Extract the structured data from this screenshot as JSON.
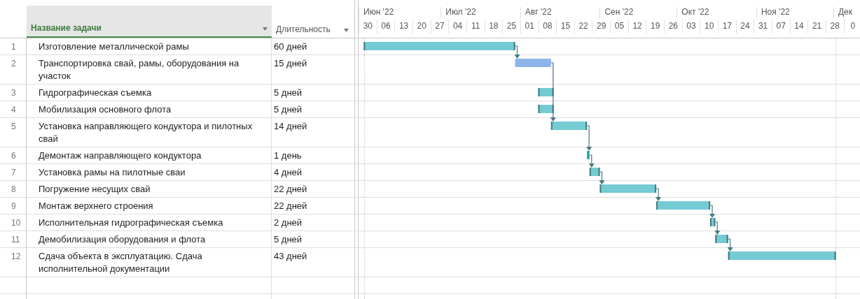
{
  "columns": [
    {
      "label": "Название задачи",
      "selected": true
    },
    {
      "label": "Длительность",
      "selected": false
    }
  ],
  "timescale": {
    "months": [
      "Июн '22",
      "Июл '22",
      "Авг '22",
      "Сен '22",
      "Окт '22",
      "Ноя '22",
      "Дек"
    ],
    "weeks": [
      "30",
      "06",
      "13",
      "20",
      "27",
      "04",
      "11",
      "18",
      "25",
      "01",
      "08",
      "15",
      "22",
      "29",
      "05",
      "12",
      "19",
      "26",
      "03",
      "10",
      "17",
      "24",
      "31",
      "07",
      "14",
      "21",
      "28",
      "0"
    ]
  },
  "tasks": [
    {
      "id": "1",
      "name": "Изготовление металлической рамы",
      "duration": "60 дней",
      "color": "#74cbd4"
    },
    {
      "id": "2",
      "name": "Транспортировка свай, рамы, оборудования на участок",
      "duration": "15 дней",
      "color": "#8db5ea"
    },
    {
      "id": "3",
      "name": "Гидрографическая съемка",
      "duration": "5 дней",
      "color": "#74cbd4"
    },
    {
      "id": "4",
      "name": "Мобилизация основного флота",
      "duration": "5 дней",
      "color": "#74cbd4"
    },
    {
      "id": "5",
      "name": "Установка направляющего кондуктора и пилотных свай",
      "duration": "14 дней",
      "color": "#74cbd4"
    },
    {
      "id": "6",
      "name": "Демонтаж направляющего кондуктора",
      "duration": "1 день",
      "color": "#2aa3ad"
    },
    {
      "id": "7",
      "name": "Установка рамы на пилотные сваи",
      "duration": "4 дней",
      "color": "#74cbd4"
    },
    {
      "id": "8",
      "name": "Погружение несущих свай",
      "duration": "22 дней",
      "color": "#74cbd4"
    },
    {
      "id": "9",
      "name": "Монтаж верхнего строения",
      "duration": "22 дней",
      "color": "#74cbd4"
    },
    {
      "id": "10",
      "name": "Исполнительная гидрографическая съемка",
      "duration": "2 дней",
      "color": "#74cbd4"
    },
    {
      "id": "11",
      "name": "Демобилизация оборудования и флота",
      "duration": "5 дней",
      "color": "#74cbd4"
    },
    {
      "id": "12",
      "name": "Сдача объекта в эксплуатацию. Сдача исполнительной документации",
      "duration": "43 дней",
      "color": "#74cbd4"
    }
  ]
}
